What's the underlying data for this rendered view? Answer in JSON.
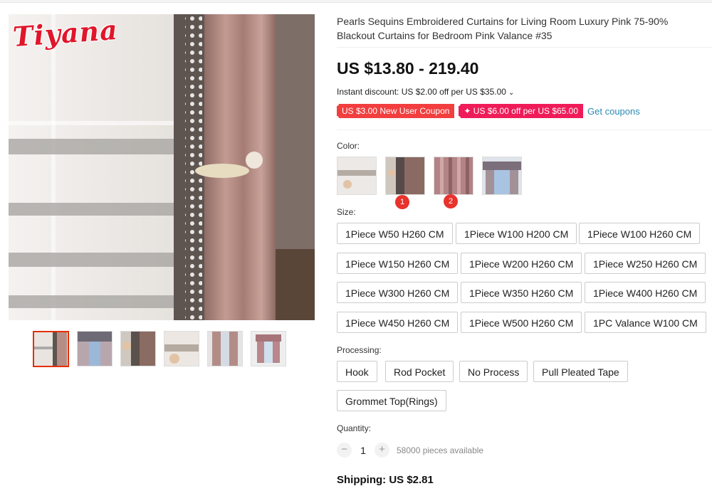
{
  "brand_logo": "Tiyana",
  "product": {
    "title": "Pearls Sequins Embroidered Curtains for Living Room Luxury Pink 75-90% Blackout Curtains for Bedroom Pink Valance #35",
    "price": "US $13.80 - 219.40",
    "instant_discount": "Instant discount: US $2.00 off per US $35.00",
    "coupons": [
      "US $3.00 New User Coupon",
      "✦ US $6.00 off per US $65.00"
    ],
    "get_coupons": "Get coupons"
  },
  "color": {
    "label": "Color:",
    "swatches": [
      "sheer-embroidered",
      "pearl-trim",
      "pink-stripe",
      "valance-blue"
    ],
    "badges": [
      "1",
      "2"
    ]
  },
  "size": {
    "label": "Size:",
    "options": [
      "1Piece W50 H260 CM",
      "1Piece W100 H200 CM",
      "1Piece W100 H260 CM",
      "1Piece W150 H260 CM",
      "1Piece W200 H260 CM",
      "1Piece W250 H260 CM",
      "1Piece W300 H260 CM",
      "1Piece W350 H260 CM",
      "1Piece W400 H260 CM",
      "1Piece W450 H260 CM",
      "1Piece W500 H260 CM",
      "1PC Valance W100 CM"
    ]
  },
  "processing": {
    "label": "Processing:",
    "options": [
      "Hook",
      "Rod Pocket",
      "No Process",
      "Pull Pleated Tape",
      "Grommet Top(Rings)"
    ]
  },
  "quantity": {
    "label": "Quantity:",
    "minus": "−",
    "value": "1",
    "plus": "+",
    "available": "58000 pieces available"
  },
  "shipping": "Shipping: US $2.81",
  "colors": {
    "accent_red": "#e62e04",
    "coupon_red": "#f23e3e",
    "coupon_pink": "#ef1c59",
    "link_blue": "#2b8ab5"
  }
}
